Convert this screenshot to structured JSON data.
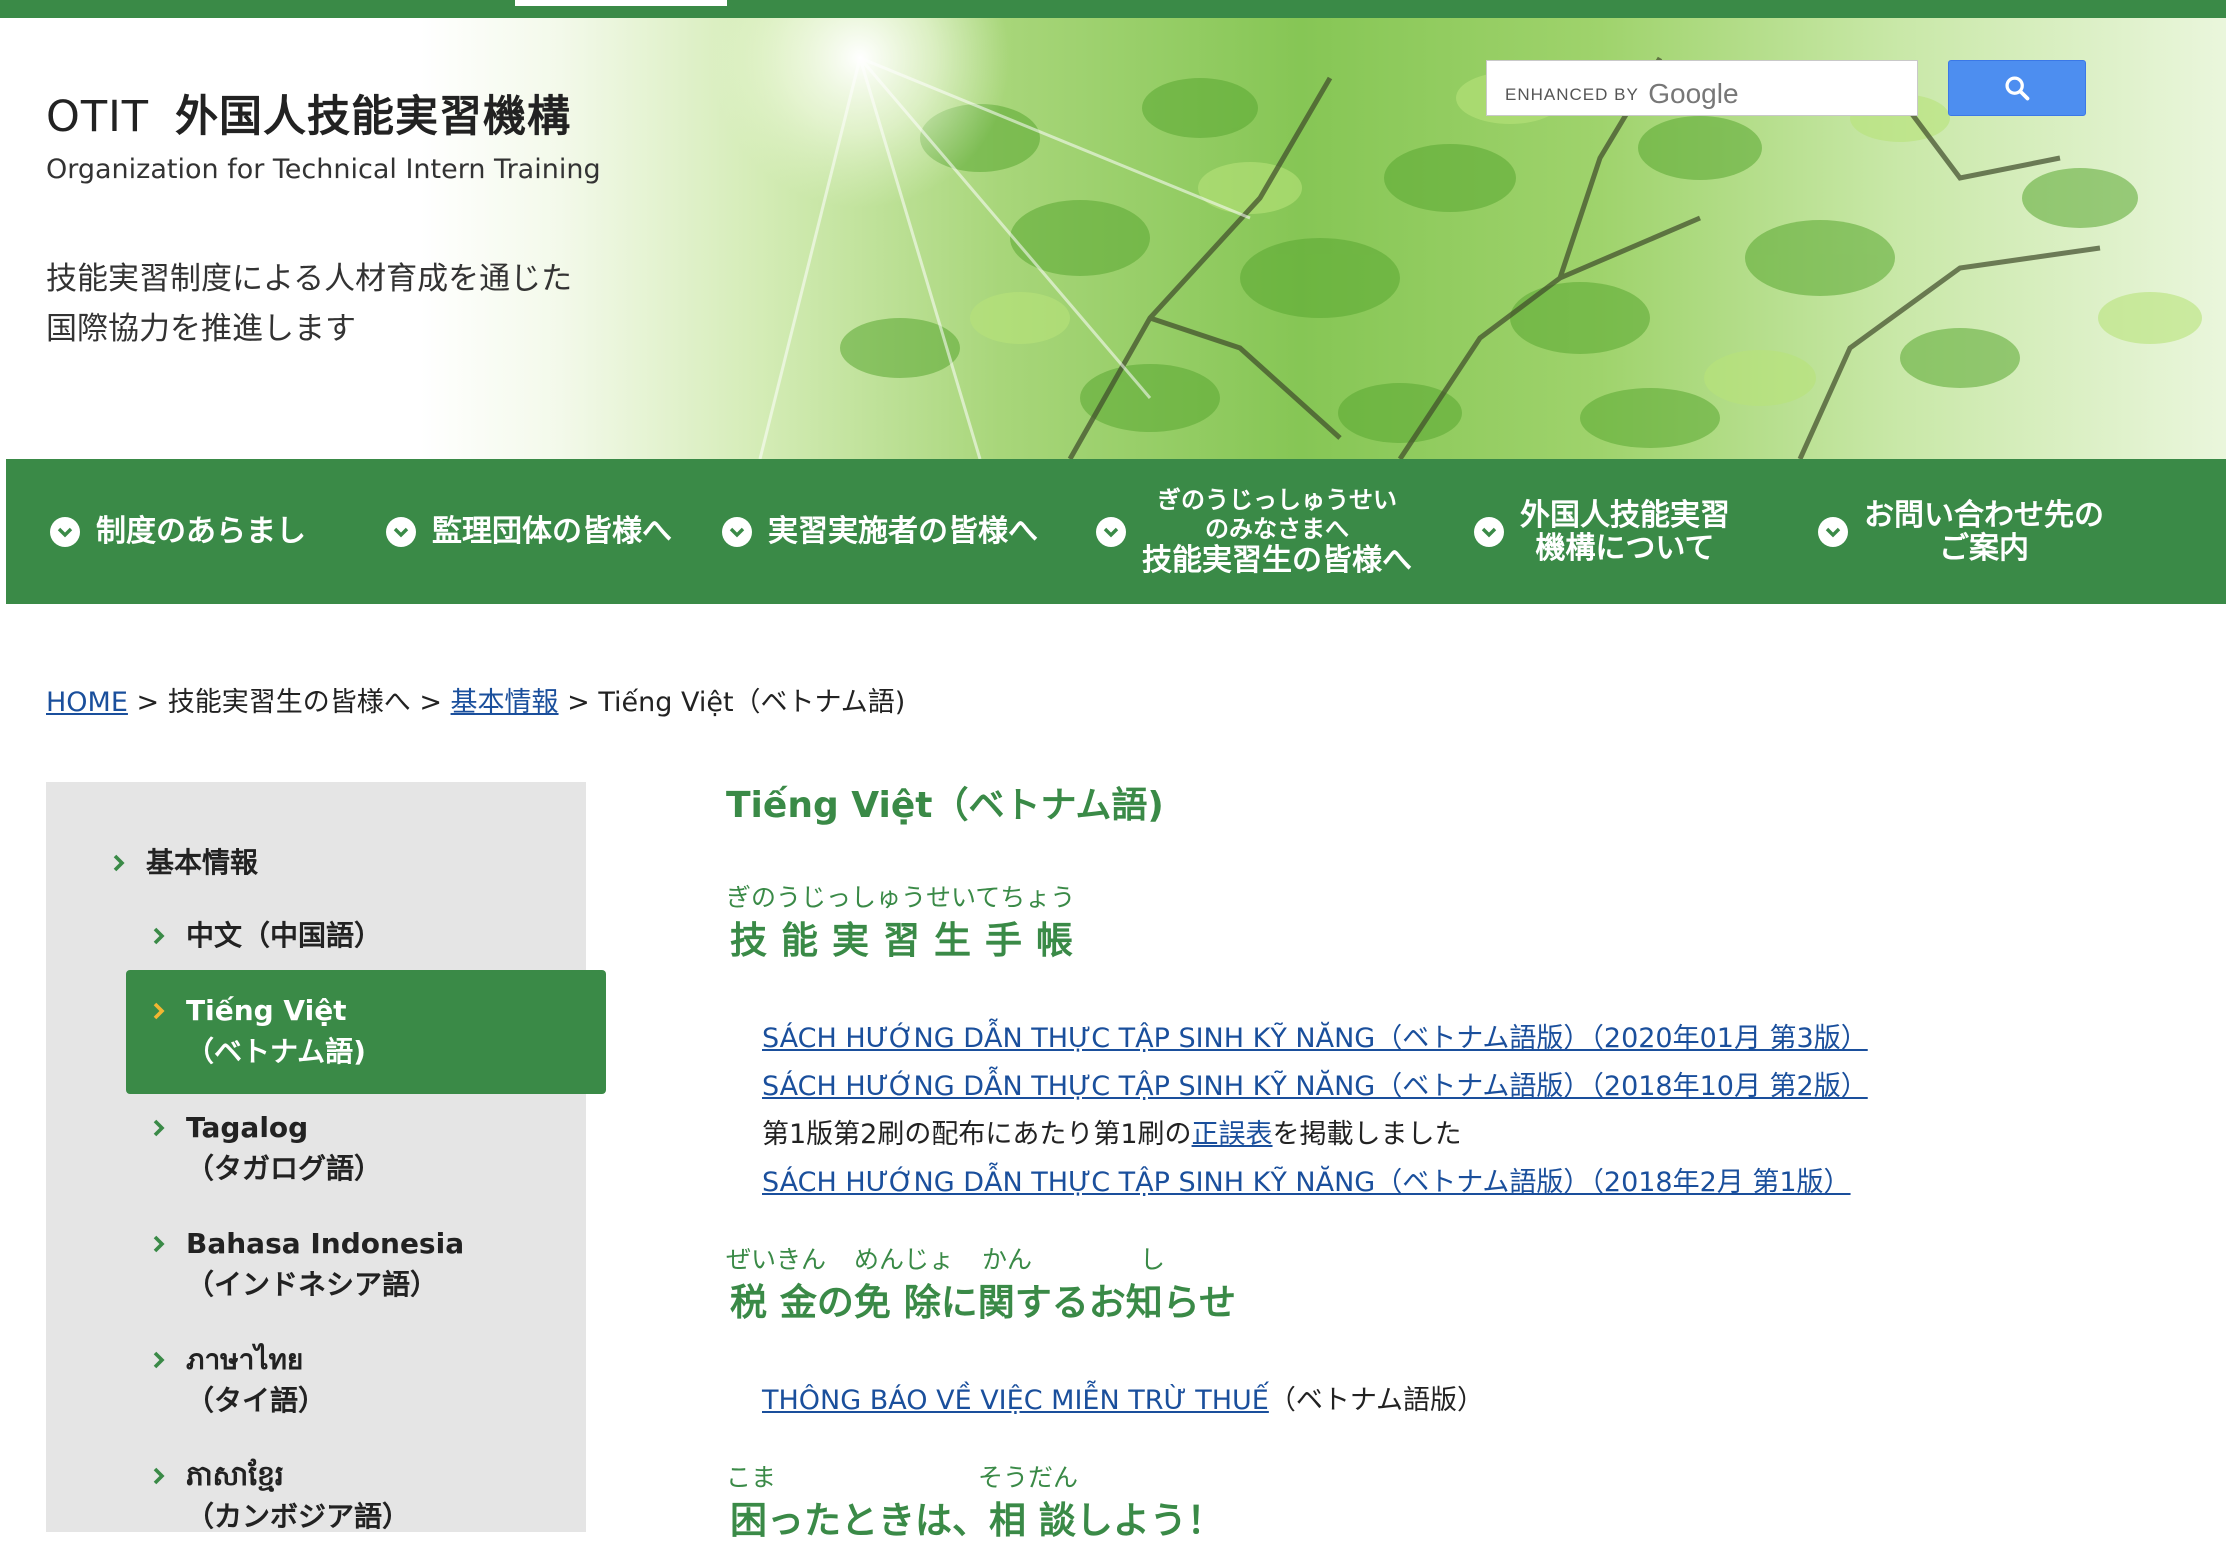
{
  "header": {
    "logo_otit": "OTIT",
    "logo_name_jp": "外国人技能実習機構",
    "logo_name_en": "Organization for Technical Intern Training",
    "tagline_line1": "技能実習制度による人材育成を通じた",
    "tagline_line2": "国際協力を推進します"
  },
  "search": {
    "enhanced_by": "ENHANCED BY",
    "google": "Google",
    "button_icon": "search-icon"
  },
  "nav": {
    "items": [
      {
        "label": "制度のあらまし"
      },
      {
        "label": "監理団体の皆様へ"
      },
      {
        "label": "実習実施者の皆様へ"
      },
      {
        "ruby_line1": "ぎのうじっしゅうせい",
        "ruby_line2": "のみなさまへ",
        "label": "技能実習生の皆様へ"
      },
      {
        "line1": "外国人技能実習",
        "line2": "機構について"
      },
      {
        "line1": "お問い合わせ先の",
        "line2": "ご案内"
      }
    ],
    "icon": "chevron-down-circle-icon"
  },
  "breadcrumb": {
    "home": "HOME",
    "sep": ">",
    "item2": "技能実習生の皆様へ",
    "item3": "基本情報",
    "current": "Tiếng Việt（ベトナム語)"
  },
  "sidebar": {
    "items": [
      {
        "label": "基本情報"
      },
      {
        "label": "中文（中国語）"
      },
      {
        "line1": "Tiếng Việt",
        "line2": "（ベトナム語)",
        "active": true
      },
      {
        "line1": "Tagalog",
        "line2": "（タガログ語）"
      },
      {
        "line1": "Bahasa Indonesia",
        "line2": "（インドネシア語）"
      },
      {
        "line1": "ภาษาไทย",
        "line2": "（タイ語）"
      },
      {
        "line1": "ភាសាខ្មែរ",
        "line2": "（カンボジア語）"
      }
    ]
  },
  "main": {
    "title": "Tiếng Việt（ベトナム語)",
    "section1": {
      "ruby": "ぎのうじっしゅうせいてちょう",
      "title": "技能実習生手帳",
      "links": [
        "SÁCH HƯỚNG DẪN THỰC TẬP SINH KỸ NĂNG（ベトナム語版）（2020年01月 第3版）",
        "SÁCH HƯỚNG DẪN THỰC TẬP SINH KỸ NĂNG（ベトナム語版）（2018年10月 第2版）"
      ],
      "note_before": "第1版第2刷の配布にあたり第1刷の",
      "note_link": "正誤表",
      "note_after": "を掲載しました",
      "link3": "SÁCH HƯỚNG DẪN THỰC TẬP SINH KỸ NĂNG（ベトナム語版）（2018年2月 第1版）"
    },
    "section2": {
      "ruby_zeikin": "ぜいきん",
      "ruby_menjo": "めんじょ",
      "ruby_kan": "かん",
      "ruby_shi": "し",
      "title_a": "税 金の免 除に関するお知らせ",
      "link": "THÔNG BÁO VỀ VIỆC MIỄN TRỪ THUẾ",
      "link_suffix": "（ベトナム語版）"
    },
    "section3": {
      "ruby_koma": "こま",
      "ruby_soudan": "そうだん",
      "title": "困ったときは、相 談しよう！"
    }
  },
  "colors": {
    "brand_green": "#3a8a47",
    "link_blue": "#1a4f9c",
    "search_blue": "#4d8ef0",
    "sidebar_bg": "#e5e5e5"
  }
}
